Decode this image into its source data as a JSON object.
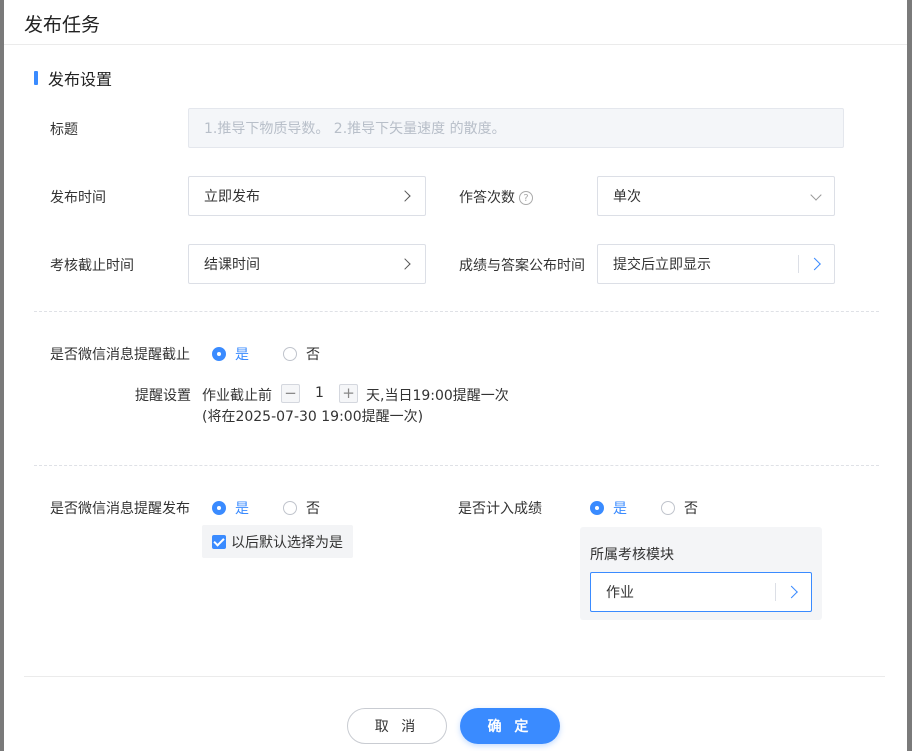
{
  "dialog": {
    "title": "发布任务"
  },
  "section": {
    "title": "发布设置"
  },
  "fields": {
    "title_label": "标题",
    "title_placeholder": "1.推导下物质导数。 2.推导下矢量速度   的散度。",
    "publish_time_label": "发布时间",
    "publish_time_value": "立即发布",
    "attempts_label": "作答次数",
    "attempts_value": "单次",
    "deadline_label": "考核截止时间",
    "deadline_value": "结课时间",
    "score_publish_label": "成绩与答案公布时间",
    "score_publish_value": "提交后立即显示"
  },
  "reminder": {
    "label": "是否微信消息提醒截止",
    "yes": "是",
    "no": "否",
    "setting_label": "提醒设置",
    "before_text": "作业截止前",
    "minus": "−",
    "days": "1",
    "plus": "+",
    "after_text": "天,当日19:00提醒一次",
    "note": "(将在2025-07-30 19:00提醒一次)"
  },
  "publish_notify": {
    "label": "是否微信消息提醒发布",
    "yes": "是",
    "no": "否",
    "default_checkbox": "以后默认选择为是"
  },
  "count_score": {
    "label": "是否计入成绩",
    "yes": "是",
    "no": "否",
    "module_label": "所属考核模块",
    "module_value": "作业"
  },
  "footer": {
    "cancel": "取 消",
    "ok": "确 定"
  },
  "colors": {
    "accent": "#3a8bff"
  }
}
